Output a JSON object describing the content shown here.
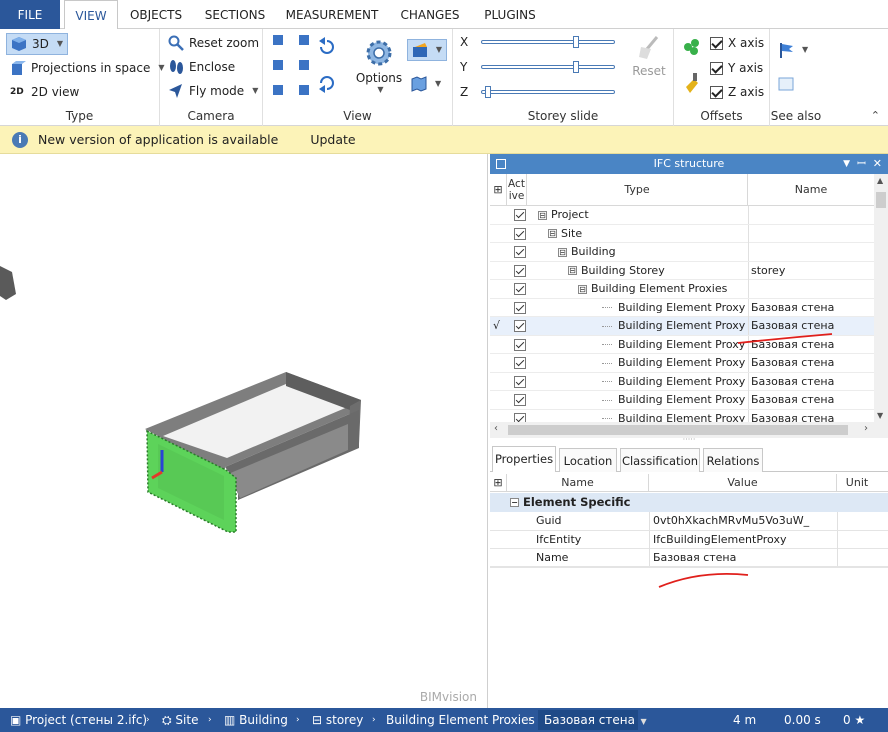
{
  "tabs": [
    "FILE",
    "VIEW",
    "OBJECTS",
    "SECTIONS",
    "MEASUREMENT",
    "CHANGES",
    "PLUGINS"
  ],
  "ribbon": {
    "type_group": {
      "label": "Type",
      "btn_3d": "3D",
      "btn_projections": "Projections in space",
      "btn_2d": "2D view"
    },
    "camera_group": {
      "label": "Camera",
      "reset_zoom": "Reset zoom",
      "enclose": "Enclose",
      "fly_mode": "Fly mode"
    },
    "view_group": {
      "label": "View",
      "options": "Options"
    },
    "storey_group": {
      "label": "Storey slide",
      "x": "X",
      "y": "Y",
      "z": "Z",
      "reset": "Reset",
      "x_value": 0.72,
      "y_value": 0.72,
      "z_value": 0.02
    },
    "offsets_group": {
      "label": "Offsets",
      "x_axis": "X axis",
      "y_axis": "Y axis",
      "z_axis": "Z axis"
    },
    "see_also_group": {
      "label": "See also"
    }
  },
  "info_bar": {
    "message": "New version of application is available",
    "action": "Update"
  },
  "viewport": {
    "watermark": "BIMvision"
  },
  "ifc_panel": {
    "title": "IFC structure",
    "columns": {
      "active": "Active",
      "type": "Type",
      "name": "Name"
    },
    "rows": [
      {
        "indent": 0,
        "expander": "⊟",
        "type": "Project",
        "name": "",
        "marker": ""
      },
      {
        "indent": 1,
        "expander": "⊟",
        "type": "Site",
        "name": "",
        "marker": ""
      },
      {
        "indent": 2,
        "expander": "⊟",
        "type": "Building",
        "name": "",
        "marker": ""
      },
      {
        "indent": 3,
        "expander": "⊟",
        "type": "Building Storey",
        "name": "storey",
        "marker": ""
      },
      {
        "indent": 4,
        "expander": "⊟",
        "type": "Building Element Proxies",
        "name": "",
        "marker": ""
      },
      {
        "indent": 5,
        "expander": "",
        "type": "Building Element Proxy",
        "name": "Базовая стена",
        "marker": ""
      },
      {
        "indent": 5,
        "expander": "",
        "type": "Building Element Proxy",
        "name": "Базовая стена",
        "marker": "√"
      },
      {
        "indent": 5,
        "expander": "",
        "type": "Building Element Proxy",
        "name": "Базовая стена",
        "marker": ""
      },
      {
        "indent": 5,
        "expander": "",
        "type": "Building Element Proxy",
        "name": "Базовая стена",
        "marker": ""
      },
      {
        "indent": 5,
        "expander": "",
        "type": "Building Element Proxy",
        "name": "Базовая стена",
        "marker": ""
      },
      {
        "indent": 5,
        "expander": "",
        "type": "Building Element Proxy",
        "name": "Базовая стена",
        "marker": ""
      },
      {
        "indent": 5,
        "expander": "",
        "type": "Building Element Proxy",
        "name": "Базовая стена",
        "marker": ""
      }
    ]
  },
  "props_panel": {
    "tabs": [
      "Properties",
      "Location",
      "Classification",
      "Relations"
    ],
    "columns": {
      "name": "Name",
      "value": "Value",
      "unit": "Unit"
    },
    "group": "Element Specific",
    "rows": [
      {
        "name": "Guid",
        "value": "0vt0hXkachMRvMu5Vo3uW_"
      },
      {
        "name": "IfcEntity",
        "value": "IfcBuildingElementProxy"
      },
      {
        "name": "Name",
        "value": "Базовая стена"
      }
    ]
  },
  "status_bar": {
    "project": "Project (стены 2.ifc)",
    "site": "Site",
    "building": "Building",
    "storey": "storey",
    "proxies": "Building Element Proxies",
    "selected": "Базовая стена",
    "distance": "4 m",
    "time": "0.00 s",
    "stars": "0 ★"
  },
  "colors": {
    "accent": "#2b579a",
    "panel_title": "#4a85c5",
    "info_bg": "#fcf3b8",
    "selection_green": "#5dd35a",
    "annotation_red": "#e0201c"
  }
}
